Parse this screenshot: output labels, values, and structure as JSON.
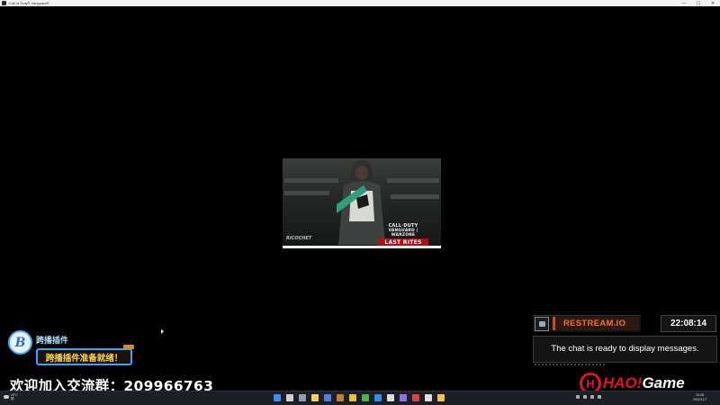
{
  "window": {
    "title": "Call of Duty® Vanguard®",
    "controls": [
      "—",
      "☐",
      "✕"
    ]
  },
  "splash": {
    "game_line1": "CALL·DUTY",
    "game_line2": "VANGUARD | WARZONE",
    "game_line3": "LAST RITES",
    "operator_tag": "RICOCHET",
    "progress": 1.0
  },
  "restream": {
    "title": "RESTREAM.IO",
    "clock": "22:08:14",
    "chat_status": "The chat is ready to display messages."
  },
  "plugin": {
    "logo_text": "B",
    "name": "跨播插件",
    "status": "跨播插件准备就绪！"
  },
  "banner": {
    "text": "欢迎加入交流群：209966763"
  },
  "watermark": {
    "h_text": "H",
    "part1": "HAO!",
    "part2": "Game"
  },
  "taskbar": {
    "weather_temp": "23°C",
    "weather_desc": "阴",
    "clock_time": "22:08",
    "clock_date": "2021/11/7",
    "icon_colors": [
      "#3b8df0",
      "#d0d0d0",
      "#8aa0b8",
      "#ffd04a",
      "#4f7fd9",
      "#c97f2b",
      "#e8c13e",
      "#4caf50",
      "#2e8fe0",
      "#ddd",
      "#9a6cf0",
      "#e04040",
      "#ddd",
      "#f3c34a"
    ],
    "accent": "#3b8df0"
  },
  "colors": {
    "restream_orange": "#ff6a2b",
    "hao_red": "#e0141f",
    "plugin_blue": "#3fa0ff",
    "plugin_yellow": "#ffd447"
  }
}
